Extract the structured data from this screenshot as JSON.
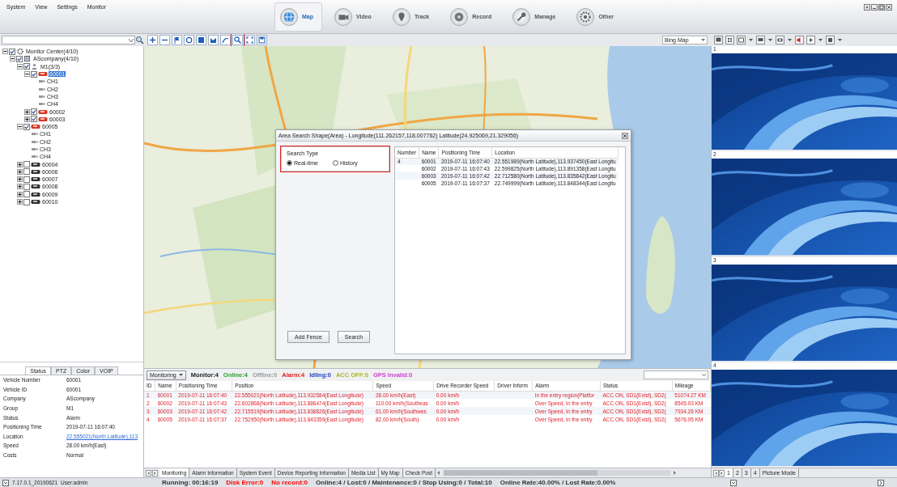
{
  "menu": [
    "System",
    "View",
    "Settings",
    "Monitor"
  ],
  "nav": [
    {
      "label": "Map",
      "kind": "map",
      "selected": true
    },
    {
      "label": "Video",
      "kind": "video",
      "selected": false
    },
    {
      "label": "Track",
      "kind": "track",
      "selected": false
    },
    {
      "label": "Record",
      "kind": "record",
      "selected": false
    },
    {
      "label": "Manage",
      "kind": "manage",
      "selected": false
    },
    {
      "label": "Other",
      "kind": "other",
      "selected": false
    }
  ],
  "map_tools": [
    {
      "kind": "zoom-in",
      "highlighted": false
    },
    {
      "kind": "zoom-out",
      "highlighted": false
    },
    {
      "kind": "flag",
      "highlighted": false
    },
    {
      "kind": "circle",
      "highlighted": false
    },
    {
      "kind": "square",
      "highlighted": false
    },
    {
      "kind": "polygon",
      "highlighted": false
    },
    {
      "kind": "line",
      "highlighted": false
    },
    {
      "kind": "search",
      "highlighted": true
    },
    {
      "kind": "fullscreen",
      "highlighted": false
    },
    {
      "kind": "save",
      "highlighted": false
    }
  ],
  "map": {
    "provider": "Bing Map"
  },
  "tree": [
    {
      "label": "Monitor Center(4/10)",
      "kind": "center",
      "checked": true,
      "expanded": true,
      "selected": false,
      "children": [
        {
          "label": "AScompany(4/10)",
          "kind": "company",
          "checked": true,
          "expanded": true,
          "selected": false,
          "children": [
            {
              "label": "M1(3/3)",
              "kind": "group",
              "checked": true,
              "expanded": true,
              "selected": false,
              "children": [
                {
                  "label": "60001",
                  "kind": "online",
                  "checked": true,
                  "expanded": true,
                  "selected": true,
                  "children": [
                    {
                      "label": "CH1",
                      "kind": "channel",
                      "selected": false
                    },
                    {
                      "label": "CH2",
                      "kind": "channel",
                      "selected": false
                    },
                    {
                      "label": "CH3",
                      "kind": "channel",
                      "selected": false
                    },
                    {
                      "label": "CH4",
                      "kind": "channel",
                      "selected": false
                    }
                  ]
                },
                {
                  "label": "60002",
                  "kind": "online",
                  "checked": true,
                  "expanded": false,
                  "selected": false
                },
                {
                  "label": "60003",
                  "kind": "online",
                  "checked": true,
                  "expanded": false,
                  "selected": false
                }
              ]
            },
            {
              "label": "60005",
              "kind": "online",
              "checked": true,
              "expanded": true,
              "selected": false,
              "children": [
                {
                  "label": "CH1",
                  "kind": "channel",
                  "selected": false
                },
                {
                  "label": "CH2",
                  "kind": "channel",
                  "selected": false
                },
                {
                  "label": "CH3",
                  "kind": "channel",
                  "selected": false
                },
                {
                  "label": "CH4",
                  "kind": "channel",
                  "selected": false
                }
              ]
            },
            {
              "label": "60004",
              "kind": "offline",
              "checked": false,
              "expanded": false,
              "selected": false
            },
            {
              "label": "60006",
              "kind": "offline",
              "checked": false,
              "expanded": false,
              "selected": false
            },
            {
              "label": "60007",
              "kind": "offline",
              "checked": false,
              "expanded": false,
              "selected": false
            },
            {
              "label": "60008",
              "kind": "offline",
              "checked": false,
              "expanded": false,
              "selected": false
            },
            {
              "label": "60009",
              "kind": "offline",
              "checked": false,
              "expanded": false,
              "selected": false
            },
            {
              "label": "60010",
              "kind": "offline",
              "checked": false,
              "expanded": false,
              "selected": false
            }
          ]
        }
      ]
    }
  ],
  "dialog": {
    "title": "Area Search Shape(Area) - Longitude(111.262157,118.007762) Latitude(24.925069,21.329056)",
    "search_type": {
      "label": "Search Type",
      "highlighted": true,
      "options": [
        {
          "label": "Real-time",
          "selected": true
        },
        {
          "label": "History",
          "selected": false
        }
      ]
    },
    "columns": [
      "Number",
      "Name",
      "Positioning Time",
      "Location"
    ],
    "rows": [
      {
        "number": "4",
        "name": "60001",
        "time": "2019-07-11 16:07:40",
        "location": "22.551989(North Latitude),113.937450(East Longitu"
      },
      {
        "name": "60002",
        "time": "2019-07-11 16:07:43",
        "location": "22.599825(North Latitude),113.891358(East Longitu"
      },
      {
        "name": "60003",
        "time": "2019-07-11 16:07:42",
        "location": "22.712580(North Latitude),113.835842(East Longitu"
      },
      {
        "name": "60005",
        "time": "2019-07-11 16:07:37",
        "location": "22.749999(North Latitude),113.848344(East Longitu"
      }
    ],
    "buttons": [
      "Add Fence",
      "Search"
    ]
  },
  "monitor": {
    "filter": "Monitoring",
    "stats": [
      {
        "label": "Monitor:4",
        "color": "#222222"
      },
      {
        "label": "Online:4",
        "color": "#2a9d2a"
      },
      {
        "label": "Offline:0",
        "color": "#999999"
      },
      {
        "label": "Alarm:4",
        "color": "#e02020"
      },
      {
        "label": "Idling:0",
        "color": "#2040c0"
      },
      {
        "label": "ACC OFF:0",
        "color": "#a8b820"
      },
      {
        "label": "GPS Invalid:0",
        "color": "#d040d0"
      }
    ],
    "columns": [
      "ID",
      "Name",
      "Positioning Time",
      "Position",
      "Speed",
      "Drive Recorder Speed",
      "Driver Inform",
      "Alarm",
      "Status",
      "Mileage"
    ],
    "rows": [
      {
        "alarm": true,
        "id": "1",
        "name": "60001",
        "time": "2019-07-11 16:07:40",
        "position": "22.555021(North Latitude),113.932584(East Longitude)",
        "speed": "28.00 km/h(East)",
        "recorder_speed": "0.00 km/h",
        "alarm_text": "In the entry region(Platfor",
        "status": "ACC ON, SD1(Exist), SD2(",
        "mileage": "51074.27 KM"
      },
      {
        "alarm": true,
        "id": "2",
        "name": "60002",
        "time": "2019-07-11 16:07:43",
        "position": "22.602868(North Latitude),113.886474(East Longitude)",
        "speed": "110.00 km/h(Southeas",
        "recorder_speed": "0.00 km/h",
        "alarm_text": "Over Speed, In the entry",
        "status": "ACC ON, SD1(Exist), SD2(",
        "mileage": "8545.93 KM"
      },
      {
        "alarm": true,
        "id": "3",
        "name": "60003",
        "time": "2019-07-11 16:07:42",
        "position": "22.715519(North Latitude),113.838826(East Longitude)",
        "speed": "61.00 km/h(Southwes",
        "recorder_speed": "0.00 km/h",
        "alarm_text": "Over Speed, In the entry",
        "status": "ACC ON, SD1(Exist), SD2(",
        "mileage": "7934.26 KM"
      },
      {
        "alarm": true,
        "id": "4",
        "name": "60005",
        "time": "2019-07-11 16:07:37",
        "position": "22.752950(North Latitude),113.843359(East Longitude)",
        "speed": "82.00 km/h(South)",
        "recorder_speed": "0.00 km/h",
        "alarm_text": "Over Speed, In the entry",
        "status": "ACC ON, SD1(Exist), SD2(",
        "mileage": "5676.95 KM"
      }
    ]
  },
  "bottom_tabs": [
    {
      "label": "Monitoring",
      "selected": true
    },
    {
      "label": "Alarm Information",
      "selected": false
    },
    {
      "label": "System Event",
      "selected": false
    },
    {
      "label": "Device Reporting Information",
      "selected": false
    },
    {
      "label": "Media List",
      "selected": false
    },
    {
      "label": "My Map",
      "selected": false
    },
    {
      "label": "Check Post",
      "selected": false
    }
  ],
  "details": {
    "tabs": [
      {
        "label": "Status",
        "selected": true
      },
      {
        "label": "PTZ",
        "selected": false
      },
      {
        "label": "Color",
        "selected": false
      },
      {
        "label": "VOIP",
        "selected": false
      }
    ],
    "rows": [
      {
        "label": "Vehicle Number",
        "value": "60001",
        "kind": "text"
      },
      {
        "label": "Vehicle ID",
        "value": "60001",
        "kind": "text"
      },
      {
        "label": "Company",
        "value": "AScompany",
        "kind": "text"
      },
      {
        "label": "Group",
        "value": "M1",
        "kind": "text"
      },
      {
        "label": "Status",
        "value": "Alarm",
        "kind": "text"
      },
      {
        "label": "Positioning Time",
        "value": "2019-07-11 16:07:40",
        "kind": "text"
      },
      {
        "label": "Location",
        "value": "22.555021(North Latitude),113",
        "kind": "link"
      },
      {
        "label": "Speed",
        "value": "28.00 km/h(East)",
        "kind": "text"
      },
      {
        "label": "Costs",
        "value": "Normal",
        "kind": "text"
      }
    ]
  },
  "video": {
    "panels": [
      "1",
      "2",
      "3",
      "4"
    ],
    "tabs": [
      {
        "label": "1",
        "selected": true
      },
      {
        "label": "2",
        "selected": false
      },
      {
        "label": "3",
        "selected": false
      },
      {
        "label": "4",
        "selected": false
      },
      {
        "label": "Picture Mode",
        "selected": false
      }
    ]
  },
  "status_bar": {
    "version": "7.17.0.1_20190621",
    "user": "User:admin",
    "items": [
      {
        "text": "Running: 00:16:19",
        "color": "#333333"
      },
      {
        "text": "Disk Error:0",
        "color": "#ff0000"
      },
      {
        "text": "No record:0",
        "color": "#ff0000"
      },
      {
        "text": "Online:4 / Lost:0 / Maintenance:0 / Stop Using:0 / Total:10",
        "color": "#333333"
      },
      {
        "text": "Online Rate:40.00% / Lost Rate:0.00%",
        "color": "#333333"
      }
    ]
  }
}
